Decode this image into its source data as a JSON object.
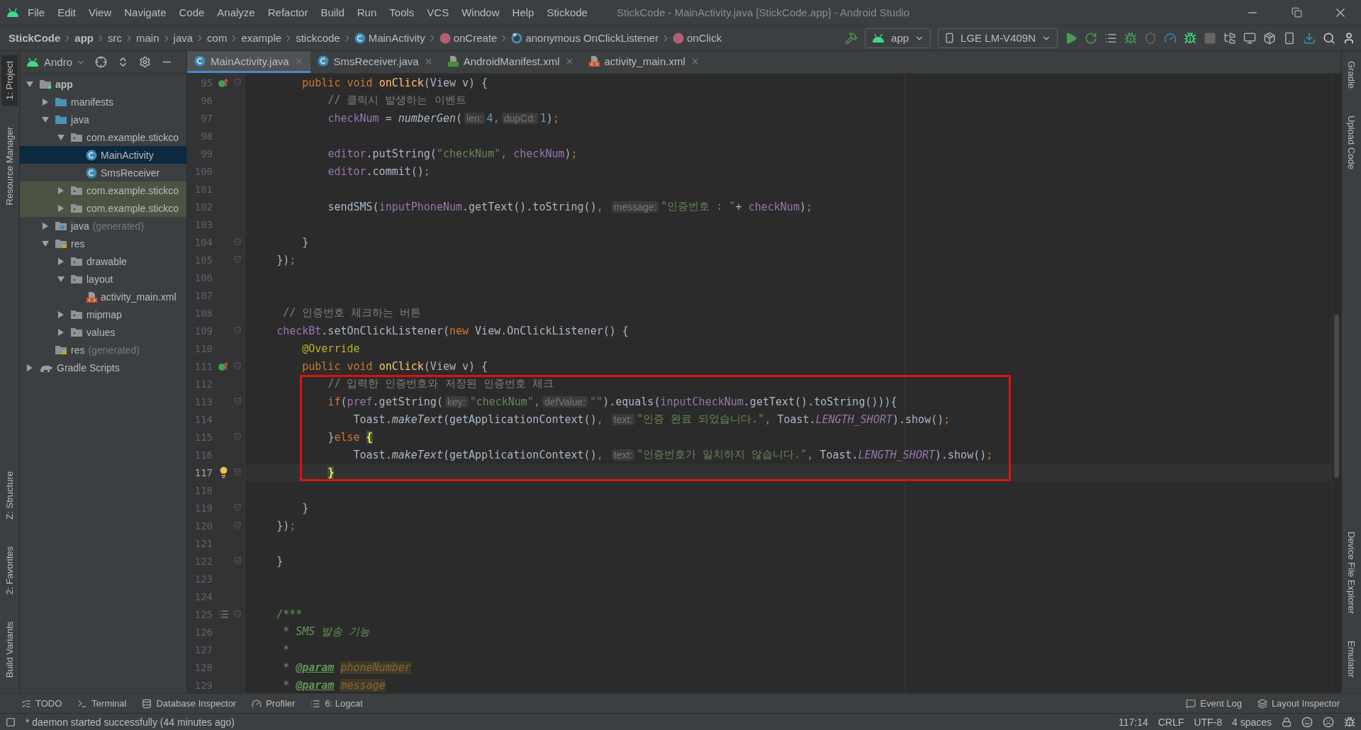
{
  "window": {
    "title": "StickCode - MainActivity.java [StickCode.app] - Android Studio"
  },
  "menu": [
    "File",
    "Edit",
    "View",
    "Navigate",
    "Code",
    "Analyze",
    "Refactor",
    "Build",
    "Run",
    "Tools",
    "VCS",
    "Window",
    "Help",
    "Stickode"
  ],
  "breadcrumbs": [
    {
      "label": "StickCode",
      "kind": "bold"
    },
    {
      "label": "app",
      "kind": "bold"
    },
    {
      "label": "src",
      "kind": "plain"
    },
    {
      "label": "main",
      "kind": "plain"
    },
    {
      "label": "java",
      "kind": "plain"
    },
    {
      "label": "com",
      "kind": "plain"
    },
    {
      "label": "example",
      "kind": "plain"
    },
    {
      "label": "stickcode",
      "kind": "plain"
    },
    {
      "label": "MainActivity",
      "kind": "class"
    },
    {
      "label": "onCreate",
      "kind": "method"
    },
    {
      "label": "anonymous OnClickListener",
      "kind": "anonymous"
    },
    {
      "label": "onClick",
      "kind": "method"
    }
  ],
  "run_config": {
    "module": "app",
    "device": "LGE LM-V409N"
  },
  "left_stripe": {
    "top": [
      {
        "label": "1: Project",
        "selected": true
      },
      {
        "label": "Resource Manager",
        "selected": false
      }
    ],
    "bottom": [
      {
        "label": "Z: Structure",
        "selected": false
      },
      {
        "label": "2: Favorites",
        "selected": false
      },
      {
        "label": "Build Variants",
        "selected": false
      }
    ]
  },
  "right_stripe": {
    "top": [
      "Gradle",
      "Upload Code"
    ],
    "bottom": [
      "Device File Explorer",
      "Emulator"
    ]
  },
  "project": {
    "view": "Andro",
    "tree": [
      {
        "label": "app",
        "kind": "module",
        "expanded": true,
        "selected": false,
        "marked": false,
        "children": [
          {
            "label": "manifests",
            "kind": "folder",
            "expanded": false,
            "selected": false,
            "marked": false
          },
          {
            "label": "java",
            "kind": "folder",
            "expanded": true,
            "selected": false,
            "marked": false,
            "children": [
              {
                "label": "com.example.stickco",
                "kind": "package",
                "expanded": true,
                "selected": false,
                "marked": false,
                "children": [
                  {
                    "label": "MainActivity",
                    "kind": "class",
                    "selected": true,
                    "marked": false
                  },
                  {
                    "label": "SmsReceiver",
                    "kind": "class",
                    "selected": false,
                    "marked": false
                  }
                ]
              },
              {
                "label": "com.example.stickco",
                "kind": "package",
                "expanded": false,
                "selected": false,
                "marked": true
              },
              {
                "label": "com.example.stickco",
                "kind": "package",
                "expanded": false,
                "selected": false,
                "marked": true
              }
            ]
          },
          {
            "label": "java",
            "note": "(generated)",
            "kind": "generated",
            "expanded": false,
            "selected": false,
            "marked": false
          },
          {
            "label": "res",
            "kind": "resources",
            "expanded": true,
            "selected": false,
            "marked": false,
            "children": [
              {
                "label": "drawable",
                "kind": "package",
                "expanded": false,
                "selected": false,
                "marked": false
              },
              {
                "label": "layout",
                "kind": "package",
                "expanded": true,
                "selected": false,
                "marked": false,
                "children": [
                  {
                    "label": "activity_main.xml",
                    "kind": "xml",
                    "selected": false,
                    "marked": false
                  }
                ]
              },
              {
                "label": "mipmap",
                "kind": "package",
                "expanded": false,
                "selected": false,
                "marked": false
              },
              {
                "label": "values",
                "kind": "package",
                "expanded": false,
                "selected": false,
                "marked": false
              }
            ]
          },
          {
            "label": "res",
            "note": "(generated)",
            "kind": "resources",
            "selected": false,
            "marked": false
          }
        ]
      },
      {
        "label": "Gradle Scripts",
        "kind": "gradle",
        "expanded": false,
        "selected": false,
        "marked": false
      }
    ]
  },
  "tabs": [
    {
      "label": "MainActivity.java",
      "kind": "class",
      "selected": true
    },
    {
      "label": "SmsReceiver.java",
      "kind": "class",
      "selected": false
    },
    {
      "label": "AndroidManifest.xml",
      "kind": "manifest",
      "selected": false
    },
    {
      "label": "activity_main.xml",
      "kind": "xml",
      "selected": false
    }
  ],
  "code": {
    "lines": [
      {
        "num": "95",
        "kind": "override",
        "fold": true,
        "current": false,
        "framed": false,
        "tokens": [
          {
            "kind": "kw",
            "text": "        public void "
          },
          {
            "kind": "fn",
            "text": "onClick"
          },
          {
            "kind": "plain",
            "text": "(View v) {"
          }
        ]
      },
      {
        "num": "96",
        "kind": "code",
        "fold": false,
        "current": false,
        "framed": false,
        "tokens": [
          {
            "kind": "cmt",
            "text": "            // 클릭시 발생하는 이벤트"
          }
        ]
      },
      {
        "num": "97",
        "kind": "code",
        "fold": false,
        "current": false,
        "framed": false,
        "tokens": [
          {
            "kind": "field",
            "text": "            checkNum"
          },
          {
            "kind": "plain",
            "text": " = "
          },
          {
            "kind": "ital",
            "text": "numberGen"
          },
          {
            "kind": "plain",
            "text": "("
          },
          {
            "kind": "hint",
            "text": "len:"
          },
          {
            "kind": "num",
            "text": "4"
          },
          {
            "kind": "kw",
            "text": ","
          },
          {
            "kind": "hint",
            "text": "dupCd:"
          },
          {
            "kind": "num",
            "text": "1"
          },
          {
            "kind": "plain",
            "text": ")"
          },
          {
            "kind": "kw",
            "text": ";"
          }
        ]
      },
      {
        "num": "98",
        "kind": "code",
        "fold": false,
        "current": false,
        "framed": false
      },
      {
        "num": "99",
        "kind": "code",
        "fold": false,
        "current": false,
        "framed": false,
        "tokens": [
          {
            "kind": "field",
            "text": "            editor"
          },
          {
            "kind": "plain",
            "text": ".putString("
          },
          {
            "kind": "str",
            "text": "\"checkNum\""
          },
          {
            "kind": "kw",
            "text": ", "
          },
          {
            "kind": "field",
            "text": "checkNum"
          },
          {
            "kind": "plain",
            "text": ")"
          },
          {
            "kind": "kw",
            "text": ";"
          }
        ]
      },
      {
        "num": "100",
        "kind": "code",
        "fold": false,
        "current": false,
        "framed": false,
        "tokens": [
          {
            "kind": "field",
            "text": "            editor"
          },
          {
            "kind": "plain",
            "text": ".commit()"
          },
          {
            "kind": "kw",
            "text": ";"
          }
        ]
      },
      {
        "num": "101",
        "kind": "code",
        "fold": false,
        "current": false,
        "framed": false
      },
      {
        "num": "102",
        "kind": "code",
        "fold": false,
        "current": false,
        "framed": false,
        "tokens": [
          {
            "kind": "plain",
            "text": "            sendSMS("
          },
          {
            "kind": "field",
            "text": "inputPhoneNum"
          },
          {
            "kind": "plain",
            "text": ".getText().toString()"
          },
          {
            "kind": "kw",
            "text": ", "
          },
          {
            "kind": "hint",
            "text": "message:"
          },
          {
            "kind": "str",
            "text": "\"인증번호 : \""
          },
          {
            "kind": "plain",
            "text": "+ "
          },
          {
            "kind": "field",
            "text": "checkNum"
          },
          {
            "kind": "plain",
            "text": ")"
          },
          {
            "kind": "kw",
            "text": ";"
          }
        ]
      },
      {
        "num": "103",
        "kind": "code",
        "fold": false,
        "current": false,
        "framed": false
      },
      {
        "num": "104",
        "kind": "code",
        "fold": true,
        "current": false,
        "framed": false,
        "tokens": [
          {
            "kind": "plain",
            "text": "        }"
          }
        ]
      },
      {
        "num": "105",
        "kind": "code",
        "fold": true,
        "current": false,
        "framed": false,
        "tokens": [
          {
            "kind": "plain",
            "text": "    })"
          },
          {
            "kind": "kw",
            "text": ";"
          }
        ]
      },
      {
        "num": "106",
        "kind": "code",
        "fold": false,
        "current": false,
        "framed": false
      },
      {
        "num": "107",
        "kind": "code",
        "fold": false,
        "current": false,
        "framed": false
      },
      {
        "num": "108",
        "kind": "code",
        "fold": false,
        "current": false,
        "framed": false,
        "tokens": [
          {
            "kind": "cmt",
            "text": "     // 인증번호 체크하는 버튼"
          }
        ]
      },
      {
        "num": "109",
        "kind": "code",
        "fold": true,
        "current": false,
        "framed": false,
        "tokens": [
          {
            "kind": "field",
            "text": "    checkBt"
          },
          {
            "kind": "plain",
            "text": ".setOnClickListener("
          },
          {
            "kind": "kw",
            "text": "new "
          },
          {
            "kind": "plain",
            "text": "View.OnClickListener() {"
          }
        ]
      },
      {
        "num": "110",
        "kind": "code",
        "fold": false,
        "current": false,
        "framed": false,
        "tokens": [
          {
            "kind": "ann",
            "text": "        @Override"
          }
        ]
      },
      {
        "num": "111",
        "kind": "override",
        "fold": true,
        "current": false,
        "framed": false,
        "tokens": [
          {
            "kind": "kw",
            "text": "        public void "
          },
          {
            "kind": "fn",
            "text": "onClick"
          },
          {
            "kind": "plain",
            "text": "(View v) {"
          }
        ]
      },
      {
        "num": "112",
        "kind": "code",
        "fold": false,
        "current": false,
        "framed": true,
        "tokens": [
          {
            "kind": "cmt",
            "text": "            // 입력한 인증번호와 저장된 인증번호 체크"
          }
        ]
      },
      {
        "num": "113",
        "kind": "code",
        "fold": true,
        "current": false,
        "framed": true,
        "tokens": [
          {
            "kind": "kw",
            "text": "            if"
          },
          {
            "kind": "plain",
            "text": "("
          },
          {
            "kind": "field",
            "text": "pref"
          },
          {
            "kind": "plain",
            "text": ".getString("
          },
          {
            "kind": "hint",
            "text": "key:"
          },
          {
            "kind": "str",
            "text": "\"checkNum\""
          },
          {
            "kind": "kw",
            "text": ","
          },
          {
            "kind": "hint",
            "text": "defValue:"
          },
          {
            "kind": "str",
            "text": "\"\""
          },
          {
            "kind": "plain",
            "text": ").equals("
          },
          {
            "kind": "field",
            "text": "inputCheckNum"
          },
          {
            "kind": "plain",
            "text": ".getText().toString())){"
          }
        ]
      },
      {
        "num": "114",
        "kind": "code",
        "fold": false,
        "current": false,
        "framed": true,
        "tokens": [
          {
            "kind": "plain",
            "text": "                Toast."
          },
          {
            "kind": "ital",
            "text": "makeText"
          },
          {
            "kind": "plain",
            "text": "(getApplicationContext()"
          },
          {
            "kind": "kw",
            "text": ", "
          },
          {
            "kind": "hint",
            "text": "text:"
          },
          {
            "kind": "str",
            "text": "\"인증 완료 되었습니다.\""
          },
          {
            "kind": "kw",
            "text": ", "
          },
          {
            "kind": "plain",
            "text": "Toast."
          },
          {
            "kind": "const",
            "text": "LENGTH_SHORT"
          },
          {
            "kind": "plain",
            "text": ").show()"
          },
          {
            "kind": "kw",
            "text": ";"
          }
        ]
      },
      {
        "num": "115",
        "kind": "code",
        "fold": true,
        "current": false,
        "framed": true,
        "tokens": [
          {
            "kind": "plain",
            "text": "            }"
          },
          {
            "kind": "kw",
            "text": "else "
          },
          {
            "kind": "match",
            "text": "{"
          }
        ]
      },
      {
        "num": "116",
        "kind": "code",
        "fold": false,
        "current": false,
        "framed": true,
        "tokens": [
          {
            "kind": "plain",
            "text": "                Toast."
          },
          {
            "kind": "ital",
            "text": "makeText"
          },
          {
            "kind": "plain",
            "text": "(getApplicationContext()"
          },
          {
            "kind": "kw",
            "text": ", "
          },
          {
            "kind": "hint",
            "text": "text:"
          },
          {
            "kind": "str",
            "text": "\"인증번호가 일치하지 않습니다.\""
          },
          {
            "kind": "kw",
            "text": ", "
          },
          {
            "kind": "plain",
            "text": "Toast."
          },
          {
            "kind": "const",
            "text": "LENGTH_SHORT"
          },
          {
            "kind": "plain",
            "text": ").show()"
          },
          {
            "kind": "kw",
            "text": ";"
          }
        ]
      },
      {
        "num": "117",
        "kind": "bulb",
        "fold": true,
        "current": true,
        "framed": true,
        "tokens": [
          {
            "kind": "match",
            "text": "            }"
          }
        ]
      },
      {
        "num": "118",
        "kind": "code",
        "fold": false,
        "current": false,
        "framed": false
      },
      {
        "num": "119",
        "kind": "code",
        "fold": true,
        "current": false,
        "framed": false,
        "tokens": [
          {
            "kind": "plain",
            "text": "        }"
          }
        ]
      },
      {
        "num": "120",
        "kind": "code",
        "fold": true,
        "current": false,
        "framed": false,
        "tokens": [
          {
            "kind": "plain",
            "text": "    })"
          },
          {
            "kind": "kw",
            "text": ";"
          }
        ]
      },
      {
        "num": "121",
        "kind": "code",
        "fold": false,
        "current": false,
        "framed": false
      },
      {
        "num": "122",
        "kind": "code",
        "fold": true,
        "current": false,
        "framed": false,
        "tokens": [
          {
            "kind": "plain",
            "text": "    }"
          }
        ]
      },
      {
        "num": "123",
        "kind": "code",
        "fold": false,
        "current": false,
        "framed": false
      },
      {
        "num": "124",
        "kind": "code",
        "fold": false,
        "current": false,
        "framed": false
      },
      {
        "num": "125",
        "kind": "doc",
        "fold": true,
        "current": false,
        "framed": false,
        "tokens": [
          {
            "kind": "doc",
            "text": "    /***"
          }
        ]
      },
      {
        "num": "126",
        "kind": "code",
        "fold": false,
        "current": false,
        "framed": false,
        "tokens": [
          {
            "kind": "doc",
            "text": "     * SMS 발송 기능"
          }
        ]
      },
      {
        "num": "127",
        "kind": "code",
        "fold": false,
        "current": false,
        "framed": false,
        "tokens": [
          {
            "kind": "doc",
            "text": "     *"
          }
        ]
      },
      {
        "num": "128",
        "kind": "code",
        "fold": false,
        "current": false,
        "framed": false,
        "tokens": [
          {
            "kind": "doc",
            "text": "     * "
          },
          {
            "kind": "doctag",
            "text": "@param"
          },
          {
            "kind": "docparam",
            "text": " phoneNumber"
          }
        ]
      },
      {
        "num": "129",
        "kind": "code",
        "fold": false,
        "current": false,
        "framed": false,
        "tokens": [
          {
            "kind": "doc",
            "text": "     * "
          },
          {
            "kind": "doctag",
            "text": "@param"
          },
          {
            "kind": "docparam",
            "text": " message"
          }
        ]
      }
    ]
  },
  "bottom_tools": {
    "left": [
      {
        "label": "TODO",
        "kind": "todo"
      },
      {
        "label": "Terminal",
        "kind": "terminal"
      },
      {
        "label": "Database Inspector",
        "kind": "database"
      },
      {
        "label": "Profiler",
        "kind": "profiler"
      },
      {
        "label": "6: Logcat",
        "kind": "logcat"
      }
    ],
    "right": [
      {
        "label": "Event Log",
        "kind": "events"
      },
      {
        "label": "Layout Inspector",
        "kind": "layout"
      }
    ]
  },
  "status_bar": {
    "message": "* daemon started successfully (44 minutes ago)",
    "items": [
      "117:14",
      "CRLF",
      "UTF-8",
      "4 spaces"
    ]
  }
}
